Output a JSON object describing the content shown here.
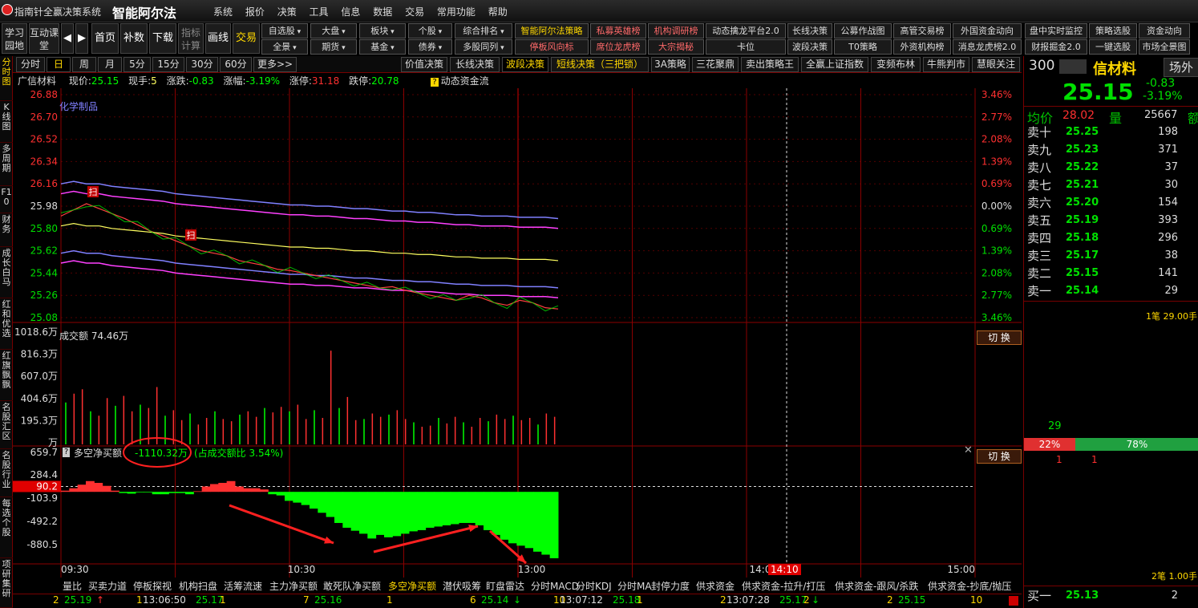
{
  "window": {
    "title": "指南针全赢决策系统",
    "brand": "智能阿尔法"
  },
  "menu": [
    "系统",
    "报价",
    "决策",
    "工具",
    "信息",
    "数据",
    "交易",
    "常用功能",
    "帮助"
  ],
  "toolbar": {
    "learn": "学习园地",
    "interact": "互动课堂",
    "home": "首页",
    "supplement": "补数",
    "download": "下载",
    "indicator": "指标计算",
    "draw": "画线",
    "trade": "交易"
  },
  "dropdowns_row1": [
    "自选股",
    "大盘",
    "板块",
    "个股",
    "综合排名"
  ],
  "dropdowns_row2": [
    "全景",
    "期货",
    "基金",
    "债券",
    "多股同列"
  ],
  "feature_row1": [
    "智能阿尔法策略",
    "私募英雄榜",
    "机构调研榜",
    "动态擒龙平台2.0",
    "长线决策",
    "公募作战图",
    "高管交易榜",
    "外国资金动向",
    "盘中实时监控",
    "策略选股",
    "资金动向"
  ],
  "feature_row2": [
    "停板风向标",
    "席位龙虎榜",
    "大宗揭秘",
    "卡位",
    "波段决策",
    "T0策略",
    "外资机构榜",
    "消息龙虎榜2.0",
    "财报掘金2.0",
    "一键选股",
    "市场全景图"
  ],
  "leftnav": [
    "分时图",
    "K线图",
    "多周期",
    "F10",
    "财务",
    "成长白马",
    "红和优选",
    "红旗飘飘",
    "名股汇区",
    "名股行业",
    "每选个股",
    "项研集研"
  ],
  "timeframes": [
    "分时",
    "日",
    "周",
    "月",
    "5分",
    "15分",
    "30分",
    "60分",
    "更多>>"
  ],
  "strategy_tabs": [
    "价值决策",
    "长线决策",
    "波段决策",
    "短线决策（三把锁）",
    "3A策略",
    "三花聚鼎",
    "卖出策略王",
    "全赢上证指数",
    "变频布林",
    "牛熊判市",
    "慧眼关注"
  ],
  "info": {
    "name": "广信材料",
    "price_label": "现价:",
    "price": "25.15",
    "hand_label": "现手:",
    "hand": "5",
    "chg_label": "涨跌:",
    "chg": "-0.83",
    "pct_label": "涨幅:",
    "pct": "-3.19%",
    "limit_up_label": "涨停:",
    "limit_up": "31.18",
    "limit_down_label": "跌停:",
    "limit_down": "20.78",
    "dyn_flow": "动态资金流"
  },
  "chart": {
    "sector_label": "化学制品",
    "price_ticks": [
      "26.88",
      "26.70",
      "26.52",
      "26.34",
      "26.16",
      "25.98",
      "25.80",
      "25.62",
      "25.44",
      "25.26",
      "25.08"
    ],
    "pct_ticks": [
      "3.46%",
      "2.77%",
      "2.08%",
      "1.39%",
      "0.69%",
      "0.00%",
      "0.69%",
      "1.39%",
      "2.08%",
      "2.77%",
      "3.46%"
    ],
    "scan_marker": "扫",
    "vol_title": "成交额 74.46万",
    "vol_ticks": [
      "1018.6万",
      "816.3万",
      "607.0万",
      "404.6万",
      "195.3万",
      "万"
    ],
    "switch_label": "切 换",
    "net_title": "多空净买额",
    "net_value": "-1110.32万",
    "net_ratio": "(占成交额比 3.54%)",
    "net_ticks": [
      "659.7",
      "284.4",
      "90.2",
      "-103.9",
      "-492.2",
      "-880.5"
    ],
    "time_ticks": [
      "09:30",
      "10:30",
      "13:00",
      "14:0",
      "15:00"
    ],
    "cursor_time": "14:10",
    "close_icon": "✕",
    "colors": {
      "up": "#ff3030",
      "down": "#00ff00",
      "mid": "#ffff60",
      "band": "#ff40ff",
      "band2": "#8080ff",
      "grid": "#8b0000"
    }
  },
  "chart_data": [
    {
      "type": "line",
      "title": "",
      "ylim": [
        25.08,
        26.88
      ],
      "series": [
        {
          "color": "#ff4040",
          "values": [
            25.9,
            25.95,
            26.0,
            25.96,
            25.92,
            25.88,
            25.83,
            25.78,
            25.74,
            25.7,
            25.66,
            25.62,
            25.6,
            25.58,
            25.54,
            25.52,
            25.5,
            25.47,
            25.46,
            25.44,
            25.42,
            25.4,
            25.38,
            25.36,
            25.34,
            25.32,
            25.33,
            25.3,
            25.28,
            25.26,
            25.24,
            25.22,
            25.26,
            25.24,
            25.2,
            25.18,
            25.22,
            25.2,
            25.16,
            25.15
          ]
        },
        {
          "color": "#ffff60",
          "values": [
            25.82,
            25.84,
            25.82,
            25.82,
            25.8,
            25.79,
            25.78,
            25.77,
            25.76,
            25.74,
            25.73,
            25.72,
            25.71,
            25.7,
            25.69,
            25.68,
            25.67,
            25.66,
            25.65,
            25.65,
            25.64,
            25.64,
            25.63,
            25.62,
            25.62,
            25.61,
            25.6,
            25.6,
            25.59,
            25.59,
            25.58,
            25.57,
            25.57,
            25.56,
            25.56,
            25.56,
            25.55,
            25.55,
            25.55,
            25.54
          ]
        }
      ]
    },
    {
      "type": "bar",
      "title": "成交额",
      "ylim": [
        0,
        1018.6
      ],
      "values": [
        380,
        460,
        500,
        300,
        260,
        420,
        350,
        440,
        300,
        360,
        330,
        520,
        260,
        310,
        220,
        280,
        180,
        240,
        300,
        230,
        210,
        270,
        300,
        250,
        330,
        290,
        340,
        300,
        360,
        230,
        310,
        240,
        850,
        330,
        430,
        220,
        230,
        280,
        250,
        270,
        310,
        230,
        200,
        160,
        170,
        240,
        190,
        250,
        200,
        160,
        240,
        210,
        270,
        230,
        260,
        220,
        240,
        180,
        280,
        250
      ]
    },
    {
      "type": "bar",
      "title": "多空净买额",
      "ylim": [
        -1110.32,
        659.7
      ],
      "values": [
        20,
        60,
        120,
        180,
        150,
        100,
        20,
        -20,
        -30,
        -10,
        -10,
        -40,
        -40,
        -20,
        -20,
        -40,
        10,
        90,
        130,
        150,
        180,
        90,
        60,
        60,
        40,
        -40,
        -60,
        -150,
        -180,
        -220,
        -280,
        -350,
        -420,
        -520,
        -600,
        -650,
        -700,
        -780,
        -720,
        -760,
        -740,
        -700,
        -660,
        -640,
        -600,
        -580,
        -560,
        -540,
        -520,
        -520,
        -560,
        -640,
        -720,
        -800,
        -860,
        -900,
        -940,
        -1000,
        -1050,
        -1110
      ]
    }
  ],
  "quote": {
    "code": "300",
    "name_partial": "信材料",
    "exchange": "场外",
    "price": "25.15",
    "chg": "-0.83",
    "pct": "-3.19%",
    "avg_label": "均价",
    "avg": "28.02",
    "vol_label": "量",
    "vol": "25667",
    "amt_label": "额",
    "asks": [
      {
        "name": "卖十",
        "price": "25.25",
        "qty": "198"
      },
      {
        "name": "卖九",
        "price": "25.23",
        "qty": "371"
      },
      {
        "name": "卖八",
        "price": "25.22",
        "qty": "37"
      },
      {
        "name": "卖七",
        "price": "25.21",
        "qty": "30"
      },
      {
        "name": "卖六",
        "price": "25.20",
        "qty": "154"
      },
      {
        "name": "卖五",
        "price": "25.19",
        "qty": "393"
      },
      {
        "name": "卖四",
        "price": "25.18",
        "qty": "296"
      },
      {
        "name": "卖三",
        "price": "25.17",
        "qty": "38"
      },
      {
        "name": "卖二",
        "price": "25.15",
        "qty": "141"
      },
      {
        "name": "卖一",
        "price": "25.14",
        "qty": "29"
      }
    ],
    "order_note": "1笔 29.00手",
    "green_num": "29",
    "ratio_sell": "22%",
    "ratio_buy": "78%",
    "small1": "1",
    "small2": "1",
    "order_note2": "2笔 1.00手",
    "bid1": {
      "name": "买一",
      "price": "25.13",
      "qty": "2"
    }
  },
  "indicators": [
    "量比",
    "买卖力道",
    "停板探视",
    "机构扫盘",
    "活筹流速",
    "主力净买额",
    "敢死队净买额",
    "多空净买额",
    "潜伏吸筹",
    "盯盘雷达",
    "分时MACD",
    "分时KDJ",
    "分时MA",
    "封停力度",
    "供求资金",
    "供求资金-拉升/打压",
    "供求资金-跟风/杀跌",
    "供求资金-抄底/抛压"
  ],
  "active_indicator": "多空净买额",
  "ticker": [
    {
      "a": "2",
      "p": "25.19",
      "dir": "up"
    },
    {
      "a": "1",
      "t": "13:06:50",
      "p": "25.17"
    },
    {
      "a": "1",
      "p": "",
      "dir": ""
    },
    {
      "a": "7",
      "p": "25.16"
    },
    {
      "a": "1",
      "p": ""
    },
    {
      "a": "6",
      "p": "25.14",
      "dir": "down"
    },
    {
      "a": "10",
      "t": "13:07:12",
      "p": "25.18"
    },
    {
      "a": "1",
      "p": ""
    },
    {
      "a": "2",
      "t": "13:07:28",
      "p": "25.17",
      "dir": "down"
    },
    {
      "a": "2",
      "p": ""
    },
    {
      "a": "2",
      "p": "25.15"
    },
    {
      "a": "10",
      "p": ""
    }
  ]
}
